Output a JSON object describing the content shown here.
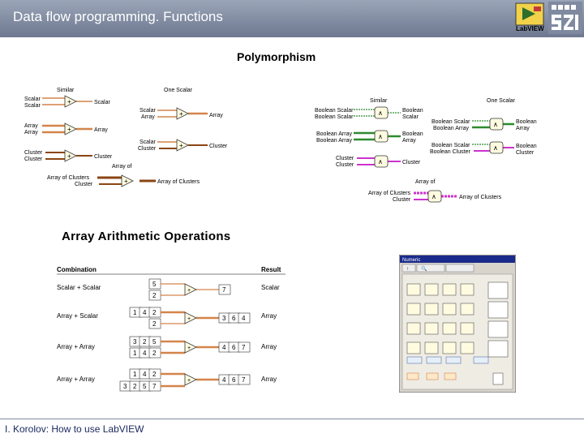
{
  "header": {
    "title": "Data flow programming. Functions",
    "logo_text": "LabVIEW"
  },
  "polymorphism": {
    "title": "Polymorphism",
    "left": {
      "col_headers": [
        "Similar",
        "One Scalar"
      ],
      "similar": [
        {
          "inputs": [
            "Scalar",
            "Scalar"
          ],
          "output": "Scalar"
        },
        {
          "inputs": [
            "Array",
            "Array"
          ],
          "output": "Array"
        },
        {
          "inputs": [
            "Cluster",
            "Cluster"
          ],
          "output": "Cluster"
        }
      ],
      "one_scalar": [
        {
          "inputs": [
            "Scalar",
            "Array"
          ],
          "output": "Array"
        },
        {
          "inputs": [
            "Scalar",
            "Cluster"
          ],
          "output": "Cluster"
        }
      ],
      "array_of": {
        "label": "Array of",
        "inputs": [
          "Array of Clusters",
          "Cluster"
        ],
        "output": "Array of Clusters"
      }
    },
    "right": {
      "col_headers": [
        "Similar",
        "One Scalar"
      ],
      "similar": [
        {
          "inputs": [
            "Boolean Scalar",
            "Boolean Scalar"
          ],
          "output": [
            "Boolean",
            "Scalar"
          ]
        },
        {
          "inputs": [
            "Boolean Array",
            "Boolean Array"
          ],
          "output": [
            "Boolean",
            "Array"
          ]
        },
        {
          "inputs": [
            "Cluster",
            "Cluster"
          ],
          "output": [
            "Cluster"
          ]
        }
      ],
      "one_scalar": [
        {
          "inputs": [
            "Boolean Scalar",
            "Boolean Array"
          ],
          "output": [
            "Boolean",
            "Array"
          ]
        },
        {
          "inputs": [
            "Boolean Scalar",
            "Boolean Cluster"
          ],
          "output": [
            "Boolean",
            "Cluster"
          ]
        }
      ],
      "array_of": {
        "label": "Array of",
        "inputs": [
          "Array of Clusters",
          "Cluster"
        ],
        "output": "Array of Clusters"
      }
    }
  },
  "arithmetic": {
    "title": "Array Arithmetic Operations",
    "header_combination": "Combination",
    "header_result": "Result",
    "rows": [
      {
        "combination": "Scalar + Scalar",
        "in1": [
          "5"
        ],
        "in2": [
          "2"
        ],
        "out": [
          "7"
        ],
        "result": "Scalar"
      },
      {
        "combination": "Array + Scalar",
        "in1": [
          "1",
          "4",
          "2"
        ],
        "in2": [
          "2"
        ],
        "out": [
          "3",
          "6",
          "4"
        ],
        "result": "Array"
      },
      {
        "combination": "Array + Array",
        "in1": [
          "3",
          "2",
          "5"
        ],
        "in2": [
          "1",
          "4",
          "2"
        ],
        "out": [
          "4",
          "6",
          "7"
        ],
        "result": "Array"
      },
      {
        "combination": "Array + Array",
        "in1": [
          "1",
          "4",
          "2"
        ],
        "in2": [
          "3",
          "2",
          "5",
          "7"
        ],
        "out": [
          "4",
          "6",
          "7"
        ],
        "result": "Array"
      }
    ]
  },
  "palette": {
    "title": "Numeric"
  },
  "footer": {
    "text": "I. Korolov: How to use LabVIEW"
  },
  "colors": {
    "header": "#7f8aa0",
    "numeric_wire": "#d4844a",
    "boolean_wire": "#2e8b2e",
    "cluster_wire": "#cc33cc",
    "array_wire": "#8b4513"
  }
}
